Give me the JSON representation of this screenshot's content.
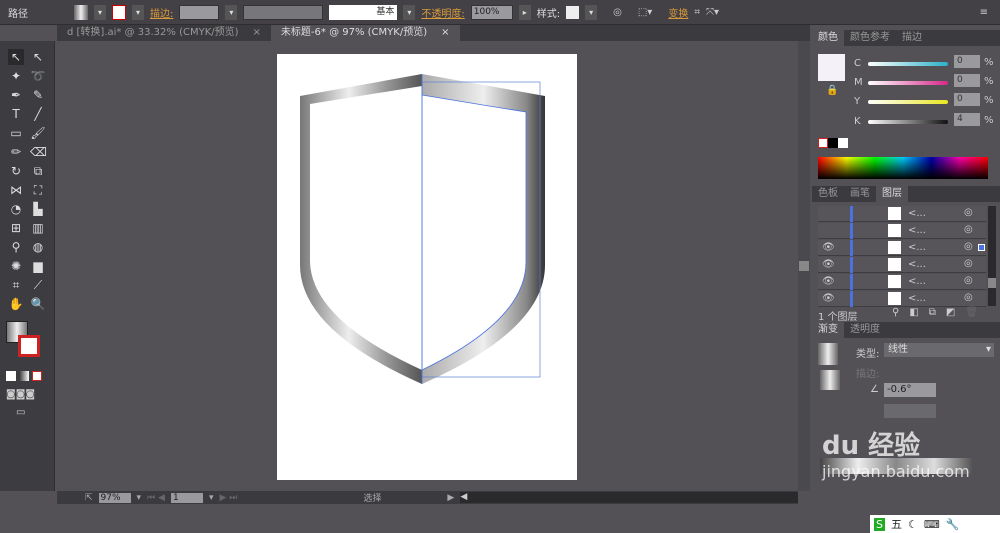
{
  "control_bar": {
    "object_type": "路径",
    "stroke_label": "描边:",
    "stroke_style": "基本",
    "opacity_label": "不透明度:",
    "opacity_value": "100%",
    "style_label": "样式:",
    "transform_label": "变换"
  },
  "tabs": [
    {
      "label": "d [转换].ai* @ 33.32% (CMYK/预览)",
      "close": "×"
    },
    {
      "label": "未标题-6* @ 97% (CMYK/预览)",
      "close": "×"
    }
  ],
  "color_panel": {
    "tabs": [
      "颜色",
      "颜色参考",
      "描边"
    ],
    "channels": [
      {
        "name": "C",
        "value": "0",
        "unit": "%",
        "color": "#2ab0c8"
      },
      {
        "name": "M",
        "value": "0",
        "unit": "%",
        "color": "#d8288a"
      },
      {
        "name": "Y",
        "value": "0",
        "unit": "%",
        "color": "#e8e620"
      },
      {
        "name": "K",
        "value": "4",
        "unit": "%",
        "color": "#111111"
      }
    ]
  },
  "layers_panel": {
    "tabs": [
      "色板",
      "画笔",
      "图层"
    ],
    "rows": [
      {
        "label": "<...",
        "visible": false
      },
      {
        "label": "<...",
        "visible": false
      },
      {
        "label": "<...",
        "visible": true,
        "selected": true
      },
      {
        "label": "<...",
        "visible": true
      },
      {
        "label": "<...",
        "visible": true
      },
      {
        "label": "<...",
        "visible": true
      }
    ],
    "footer": "1 个图层"
  },
  "gradient_panel": {
    "tabs": [
      "渐变",
      "透明度"
    ],
    "type_label": "类型:",
    "type_value": "线性",
    "stroke_label": "描边:",
    "angle": "-0.6°"
  },
  "watermark": {
    "brand": "Baidu 经验",
    "domain": "jingyan.baidu.com"
  },
  "ime": {
    "label": "五"
  },
  "status": {
    "zoom": "97%",
    "page": "1",
    "tool": "选择"
  }
}
